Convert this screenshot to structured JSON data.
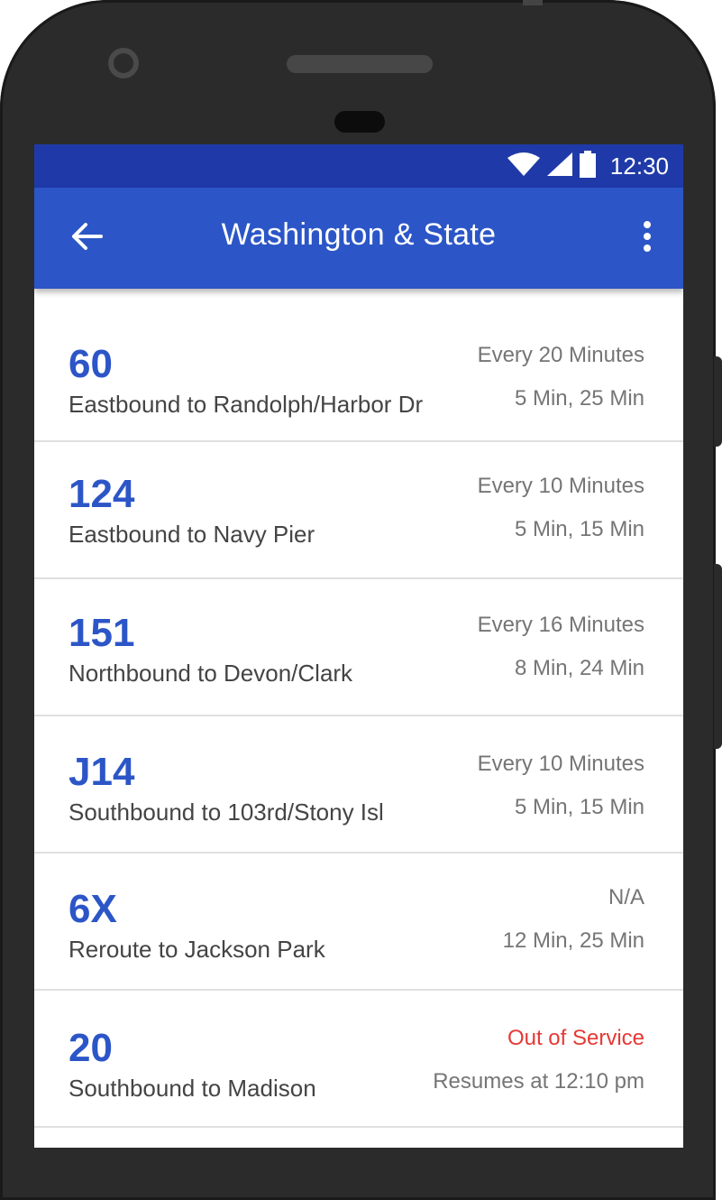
{
  "status_bar": {
    "time": "12:30",
    "icons": [
      "wifi-icon",
      "cellular-signal-icon",
      "battery-icon"
    ]
  },
  "app_bar": {
    "title": "Washington & State",
    "back_icon": "arrow-left-icon",
    "menu_icon": "more-vert-icon"
  },
  "colors": {
    "status_bar": "#1f3aa8",
    "app_bar": "#2c56c7",
    "route_number": "#2c56c7",
    "alert": "#e53935"
  },
  "routes": [
    {
      "number": "60",
      "destination": "Eastbound to Randolph/Harbor Dr",
      "frequency": "Every 20 Minutes",
      "arrivals": "5 Min, 25 Min",
      "alert": false
    },
    {
      "number": "124",
      "destination": "Eastbound to Navy Pier",
      "frequency": "Every 10 Minutes",
      "arrivals": "5 Min, 15 Min",
      "alert": false
    },
    {
      "number": "151",
      "destination": "Northbound to Devon/Clark",
      "frequency": "Every 16 Minutes",
      "arrivals": "8 Min, 24 Min",
      "alert": false
    },
    {
      "number": "J14",
      "destination": "Southbound to 103rd/Stony Isl",
      "frequency": "Every 10 Minutes",
      "arrivals": "5 Min, 15 Min",
      "alert": false
    },
    {
      "number": "6X",
      "destination": "Reroute to Jackson Park",
      "frequency": "N/A",
      "arrivals": "12 Min, 25 Min",
      "alert": false
    },
    {
      "number": "20",
      "destination": "Southbound to Madison",
      "frequency": "Out of Service",
      "arrivals": "Resumes at 12:10 pm",
      "alert": true
    }
  ]
}
